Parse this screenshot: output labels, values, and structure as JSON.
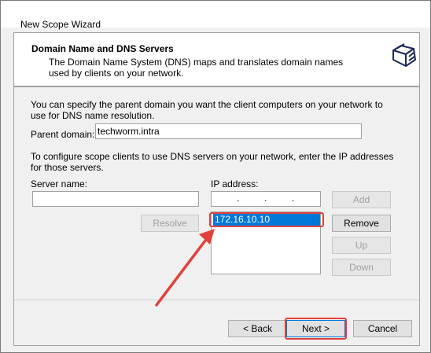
{
  "window": {
    "title": "New Scope Wizard"
  },
  "header": {
    "title": "Domain Name and DNS Servers",
    "subtitle": "The Domain Name System (DNS) maps and translates domain names used by clients on your network.",
    "icon": "folders-icon"
  },
  "panel": {
    "parent_intro": "You can specify the parent domain you want the client computers on your network to use for DNS name resolution.",
    "parent_domain_label": "Parent domain:",
    "parent_domain_value": "techworm.intra",
    "dns_intro": "To configure scope clients to use DNS servers on your network, enter the IP addresses for those servers.",
    "server_name_label": "Server name:",
    "server_name_value": "",
    "ip_address_label": "IP address:",
    "ip_list": [
      "172.16.10.10"
    ],
    "buttons": {
      "resolve": "Resolve",
      "add": "Add",
      "remove": "Remove",
      "up": "Up",
      "down": "Down"
    }
  },
  "footer": {
    "back": "< Back",
    "next": "Next >",
    "cancel": "Cancel"
  },
  "colors": {
    "annotation": "#e2403a",
    "selection": "#0078d7"
  }
}
